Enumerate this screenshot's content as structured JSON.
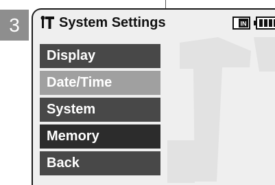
{
  "step_number": "3",
  "header": {
    "title": "System Settings",
    "settings_icon": "settings-tools-icon",
    "storage_icon": "internal-memory-icon",
    "storage_icon_text": "IN",
    "battery_icon": "battery-icon"
  },
  "menu": {
    "items": [
      {
        "label": "Display",
        "state": "normal"
      },
      {
        "label": "Date/Time",
        "state": "selected"
      },
      {
        "label": "System",
        "state": "normal"
      },
      {
        "label": "Memory",
        "state": "dark"
      },
      {
        "label": "Back",
        "state": "normal"
      }
    ]
  }
}
